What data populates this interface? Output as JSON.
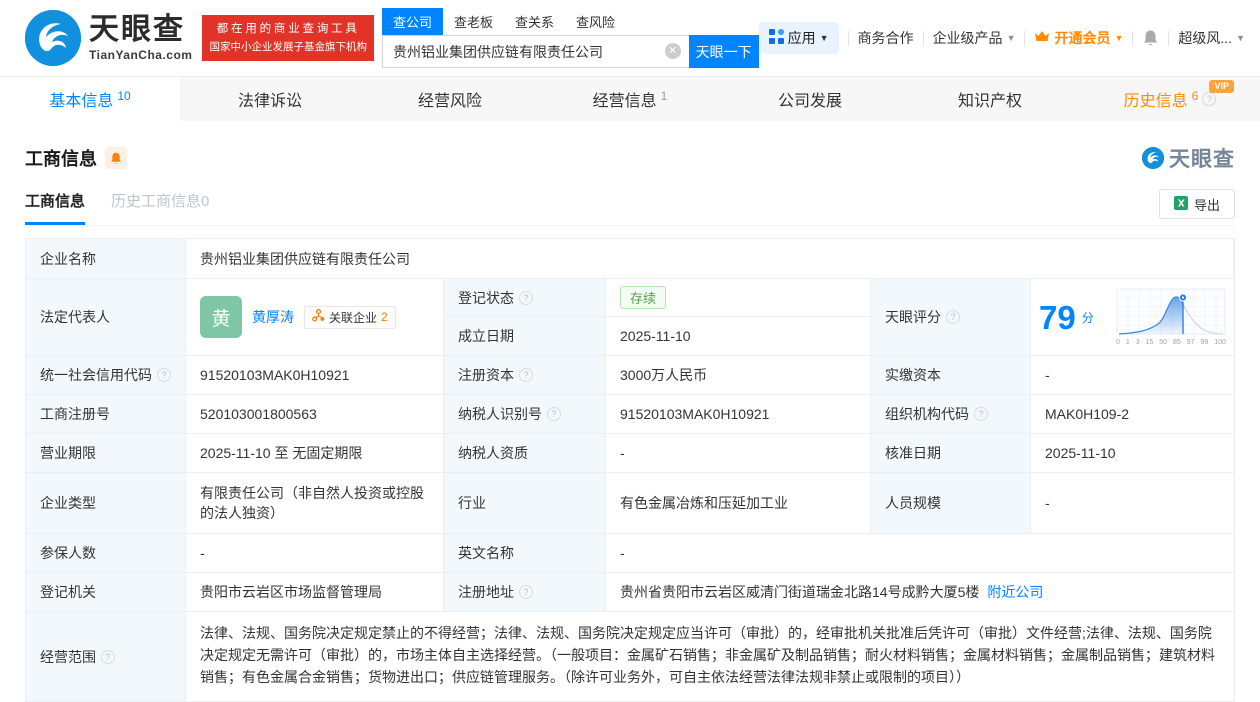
{
  "colors": {
    "accent": "#0084ff",
    "orange": "#ff8a00",
    "red": "#e23328",
    "green_text": "#52a24f",
    "avatar_green": "#7fc6a4"
  },
  "header": {
    "brand": {
      "name": "天眼查",
      "domain": "TianYanCha.com"
    },
    "promo": {
      "line1": "都在用的商业查询工具",
      "line2": "国家中小企业发展子基金旗下机构"
    },
    "search": {
      "tabs": [
        {
          "label": "查公司"
        },
        {
          "label": "查老板"
        },
        {
          "label": "查关系"
        },
        {
          "label": "查风险"
        }
      ],
      "value": "贵州铝业集团供应链有限责任公司",
      "button": "天眼一下"
    },
    "nav": {
      "apps": "应用",
      "cooperation": "商务合作",
      "enterprise": "企业级产品",
      "vip": "开通会员",
      "super_risk": "超级风..."
    }
  },
  "tabs": [
    {
      "label": "基本信息",
      "count": "10"
    },
    {
      "label": "法律诉讼",
      "count": ""
    },
    {
      "label": "经营风险",
      "count": ""
    },
    {
      "label": "经营信息",
      "count": "1"
    },
    {
      "label": "公司发展",
      "count": ""
    },
    {
      "label": "知识产权",
      "count": ""
    },
    {
      "label": "历史信息",
      "count": "6",
      "vip": "VIP"
    }
  ],
  "section": {
    "title": "工商信息",
    "watermark": "天眼查",
    "subtab_active": "工商信息",
    "subtab_history": "历史工商信息0",
    "export_label": "导出"
  },
  "table": {
    "r1": {
      "label": "企业名称",
      "value": "贵州铝业集团供应链有限责任公司"
    },
    "r2": {
      "label": "法定代表人",
      "avatar": "黄",
      "name": "黄厚涛",
      "badge_label": "关联企业",
      "badge_count": "2",
      "sub1_label": "登记状态",
      "sub1_value": "存续",
      "sub2_label": "成立日期",
      "sub2_value": "2025-11-10",
      "score_label": "天眼评分",
      "score": "79",
      "score_unit": "分"
    },
    "r3": {
      "l1": "统一社会信用代码",
      "v1": "91520103MAK0H10921",
      "l2": "注册资本",
      "v2": "3000万人民币",
      "l3": "实缴资本",
      "v3": "-"
    },
    "r4": {
      "l1": "工商注册号",
      "v1": "520103001800563",
      "l2": "纳税人识别号",
      "v2": "91520103MAK0H10921",
      "l3": "组织机构代码",
      "v3": "MAK0H109-2"
    },
    "r5": {
      "l1": "营业期限",
      "v1": "2025-11-10 至 无固定期限",
      "l2": "纳税人资质",
      "v2": "-",
      "l3": "核准日期",
      "v3": "2025-11-10"
    },
    "r6": {
      "l1": "企业类型",
      "v1": "有限责任公司（非自然人投资或控股的法人独资）",
      "l2": "行业",
      "v2": "有色金属冶炼和压延加工业",
      "l3": "人员规模",
      "v3": "-"
    },
    "r7": {
      "l1": "参保人数",
      "v1": "-",
      "l2": "英文名称",
      "v2": "-"
    },
    "r8": {
      "l1": "登记机关",
      "v1": "贵阳市云岩区市场监督管理局",
      "l2": "注册地址",
      "v2": "贵州省贵阳市云岩区威清门街道瑞金北路14号成黔大厦5楼",
      "link": "附近公司"
    },
    "r9": {
      "label": "经营范围",
      "value": "法律、法规、国务院决定规定禁止的不得经营；法律、法规、国务院决定规定应当许可（审批）的，经审批机关批准后凭许可（审批）文件经营;法律、法规、国务院决定规定无需许可（审批）的，市场主体自主选择经营。（一般项目：金属矿石销售；非金属矿及制品销售；耐火材料销售；金属材料销售；金属制品销售；建筑材料销售；有色金属合金销售；货物进出口；供应链管理服务。（除许可业务外，可自主依法经营法律法规非禁止或限制的项目））"
    }
  },
  "score_axis": [
    "0",
    "1",
    "3",
    "15",
    "50",
    "85",
    "97",
    "99",
    "100"
  ]
}
